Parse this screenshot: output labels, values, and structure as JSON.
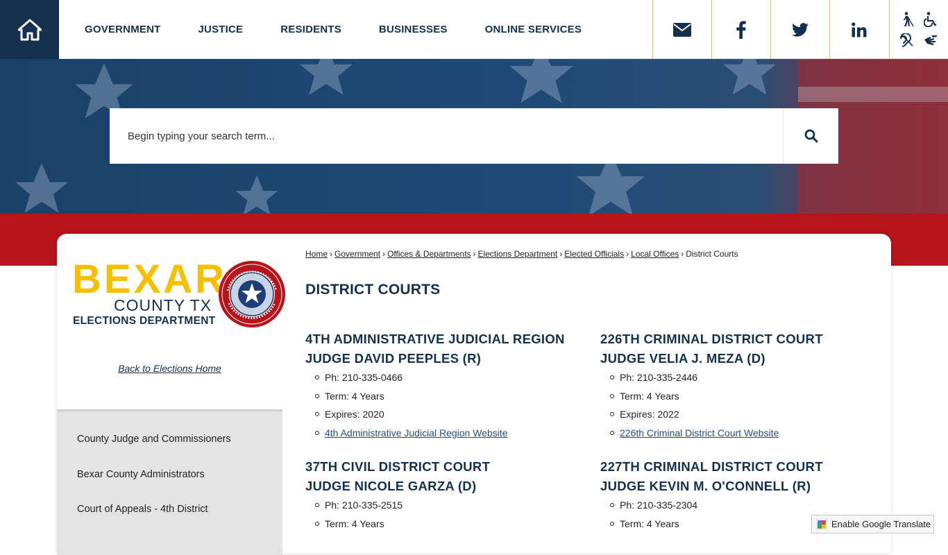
{
  "nav": {
    "items": [
      "GOVERNMENT",
      "JUSTICE",
      "RESIDENTS",
      "BUSINESSES",
      "ONLINE SERVICES"
    ]
  },
  "social": [
    "mail-icon",
    "facebook-icon",
    "twitter-icon",
    "linkedin-icon"
  ],
  "accessibility": [
    "blind-walker-icon",
    "wheelchair-icon",
    "hearing-icon",
    "sign-language-icon"
  ],
  "search": {
    "placeholder": "Begin typing your search term..."
  },
  "logo": {
    "line1": "BEXAR",
    "line2": "COUNTY TX",
    "line3": "ELECTIONS DEPARTMENT"
  },
  "sidebar": {
    "back_link": "Back to Elections Home",
    "items": [
      "County Judge and Commissioners",
      "Bexar County Administrators",
      "Court of Appeals - 4th District"
    ]
  },
  "breadcrumb": {
    "links": [
      "Home",
      "Government",
      "Offices & Departments",
      "Elections Department",
      "Elected Officials",
      "Local Offices"
    ],
    "current": "District Courts",
    "sep": "›"
  },
  "page": {
    "title": "DISTRICT COURTS"
  },
  "courts": [
    {
      "name": "4TH ADMINISTRATIVE JUDICIAL REGION",
      "judge": "JUDGE DAVID PEEPLES (R)",
      "phone": "Ph: 210-335-0466",
      "term": "Term: 4 Years",
      "expires": "Expires: 2020",
      "link": "4th Administrative Judicial Region Website"
    },
    {
      "name": "226TH CRIMINAL DISTRICT COURT",
      "judge": "JUDGE VELIA J. MEZA (D)",
      "phone": "Ph: 210-335-2446",
      "term": "Term: 4 Years",
      "expires": "Expires: 2022",
      "link": "226th Criminal District Court Website"
    },
    {
      "name": "37TH CIVIL DISTRICT COURT",
      "judge": "JUDGE NICOLE GARZA (D)",
      "phone": "Ph: 210-335-2515",
      "term": "Term: 4 Years"
    },
    {
      "name": "227TH CRIMINAL DISTRICT COURT",
      "judge": "JUDGE KEVIN M. O'CONNELL (R)",
      "phone": "Ph: 210-335-2304",
      "term": "Term: 4 Years"
    }
  ],
  "translate": {
    "label": "Enable Google Translate"
  },
  "colors": {
    "navy": "#15304f",
    "gold": "#f5c000",
    "red": "#b8141b",
    "link": "#1f4e8c"
  }
}
